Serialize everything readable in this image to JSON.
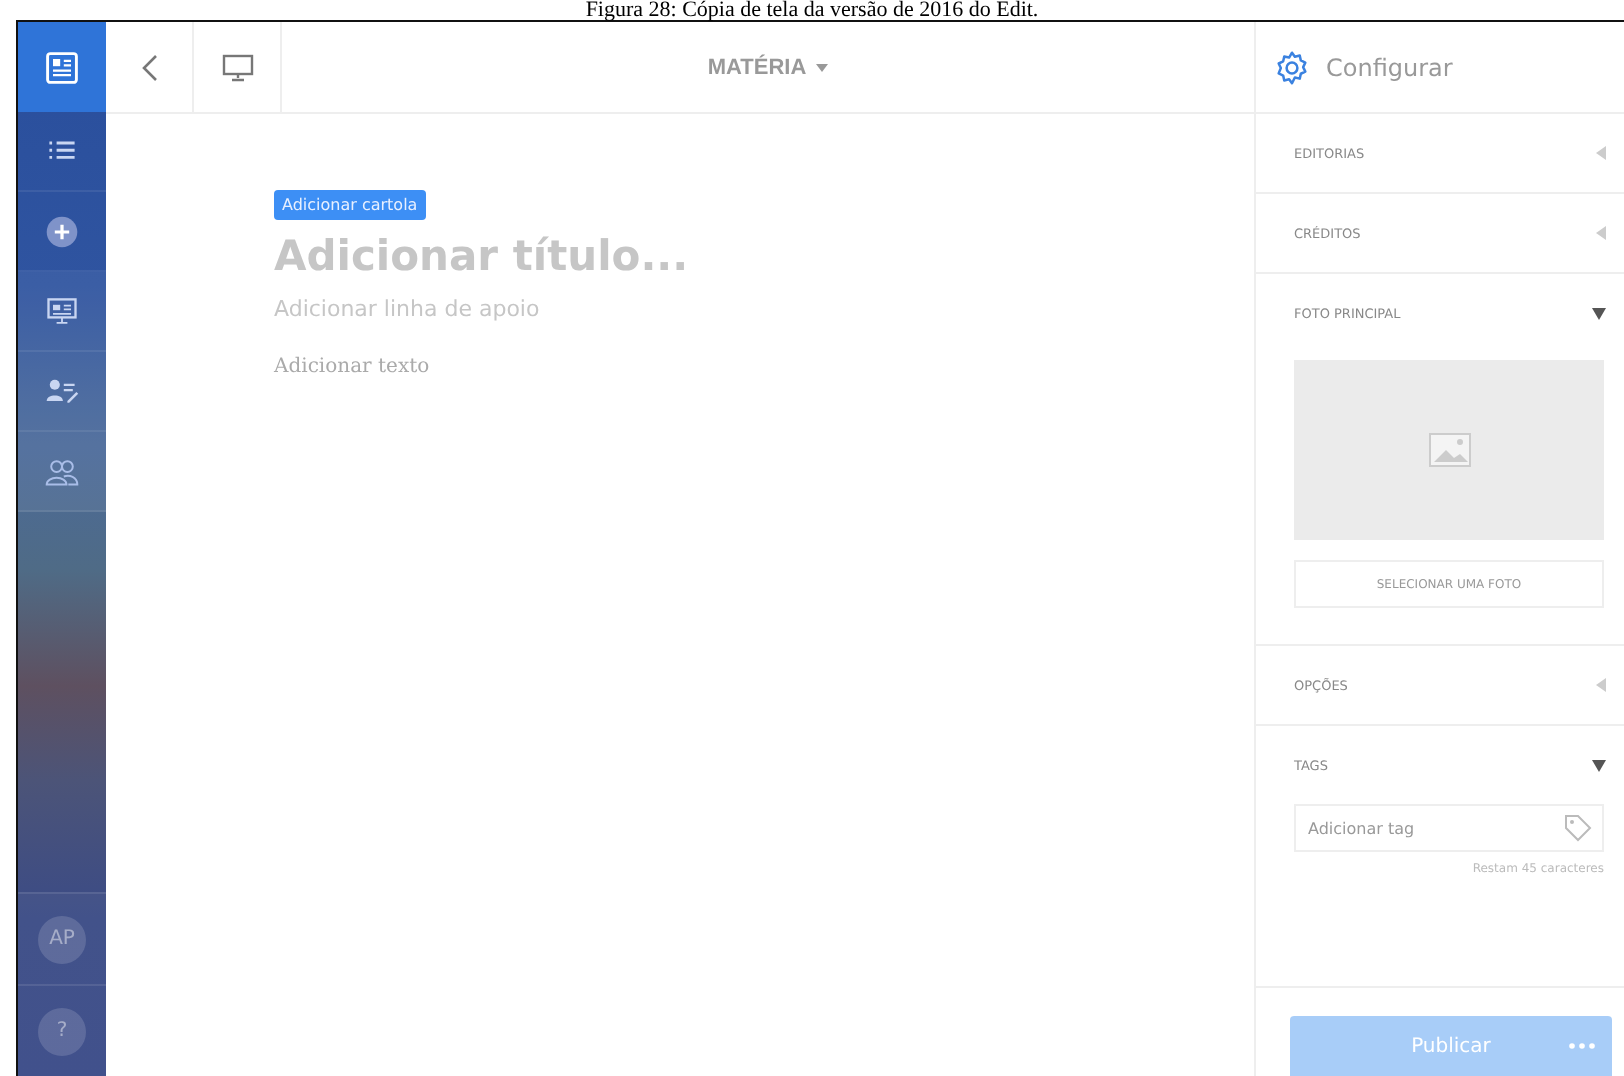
{
  "caption": "Figura 28: Cópia de tela da versão de 2016 do Edit.",
  "sidebar": {
    "items": [
      {
        "kind": "list",
        "selected": false
      },
      {
        "kind": "add",
        "selected": false
      },
      {
        "kind": "screen",
        "selected": false
      },
      {
        "kind": "author",
        "selected": false
      },
      {
        "kind": "users",
        "selected": false
      }
    ],
    "avatar": "AP",
    "help": "?"
  },
  "toolbar": {
    "title": "MATÉRIA",
    "config": "Configurar"
  },
  "editor": {
    "cartola": "Adicionar cartola",
    "title_placeholder": "Adicionar título...",
    "subtitle_placeholder": "Adicionar linha de apoio",
    "body_placeholder": "Adicionar texto"
  },
  "panel": {
    "sections": [
      {
        "kind": "plain",
        "title": "EDITORIAS",
        "expanded": false
      },
      {
        "kind": "plain",
        "title": "CRÉDITOS",
        "expanded": false
      },
      {
        "kind": "photo",
        "title": "FOTO PRINCIPAL",
        "expanded": true,
        "button": "SELECIONAR UMA FOTO"
      },
      {
        "kind": "plain",
        "title": "OPÇÕES",
        "expanded": false
      },
      {
        "kind": "tags",
        "title": "TAGS",
        "expanded": true,
        "placeholder": "Adicionar tag",
        "note": "Restam 45 caracteres"
      }
    ],
    "publish": "Publicar"
  }
}
